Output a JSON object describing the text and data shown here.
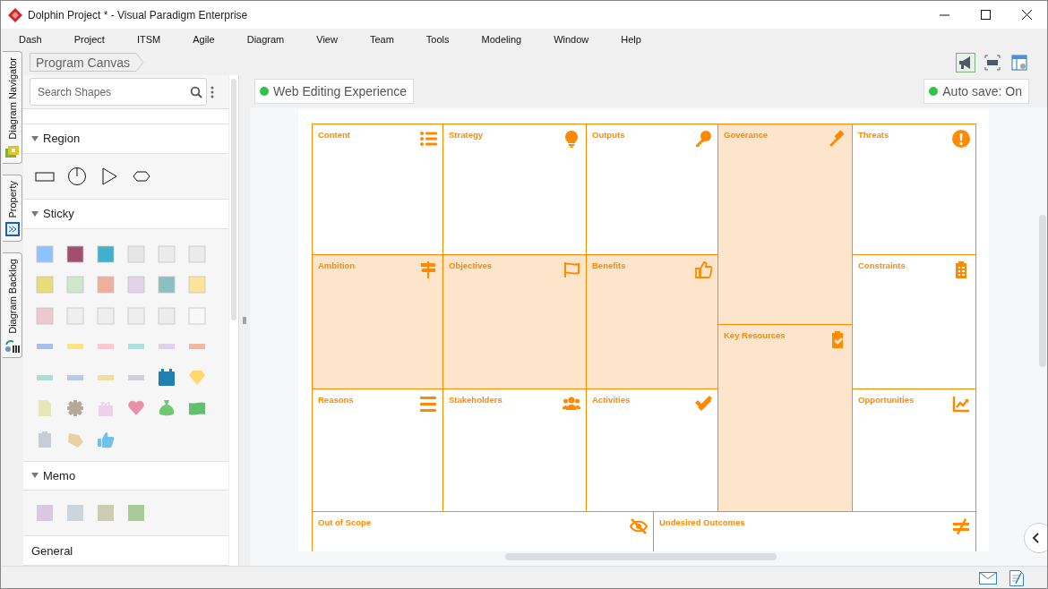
{
  "window": {
    "title": "Dolphin Project * - Visual Paradigm Enterprise"
  },
  "menu": [
    "Dash",
    "Project",
    "ITSM",
    "Agile",
    "Diagram",
    "View",
    "Team",
    "Tools",
    "Modeling",
    "Window",
    "Help"
  ],
  "side_tabs": [
    {
      "label": "Diagram Navigator"
    },
    {
      "label": "Property"
    },
    {
      "label": "Diagram Backlog"
    }
  ],
  "breadcrumb": "Program Canvas",
  "search": {
    "placeholder": "Search Shapes"
  },
  "sections": [
    {
      "title": "Region",
      "expanded": true
    },
    {
      "title": "Sticky",
      "expanded": true
    },
    {
      "title": "Memo",
      "expanded": true
    },
    {
      "title": "General"
    }
  ],
  "canvas_bar": {
    "web_editing": "Web Editing Experience",
    "auto_save": "Auto save: On"
  },
  "cells": [
    {
      "label": "Content",
      "highlighted": false
    },
    {
      "label": "Strategy",
      "highlighted": false
    },
    {
      "label": "Outputs",
      "highlighted": false
    },
    {
      "label": "Goverance",
      "highlighted": true
    },
    {
      "label": "Threats",
      "highlighted": false
    },
    {
      "label": "Ambition",
      "highlighted": true
    },
    {
      "label": "Objectives",
      "highlighted": true
    },
    {
      "label": "Benefits",
      "highlighted": true
    },
    {
      "label": "Constraints",
      "highlighted": false
    },
    {
      "label": "Key Resources",
      "highlighted": true
    },
    {
      "label": "Reasons",
      "highlighted": false
    },
    {
      "label": "Stakeholders",
      "highlighted": false
    },
    {
      "label": "Activities",
      "highlighted": false
    },
    {
      "label": "Opportunities",
      "highlighted": false
    },
    {
      "label": "Out of Scope",
      "highlighted": false
    },
    {
      "label": "Undesired Outcomes",
      "highlighted": false
    }
  ]
}
